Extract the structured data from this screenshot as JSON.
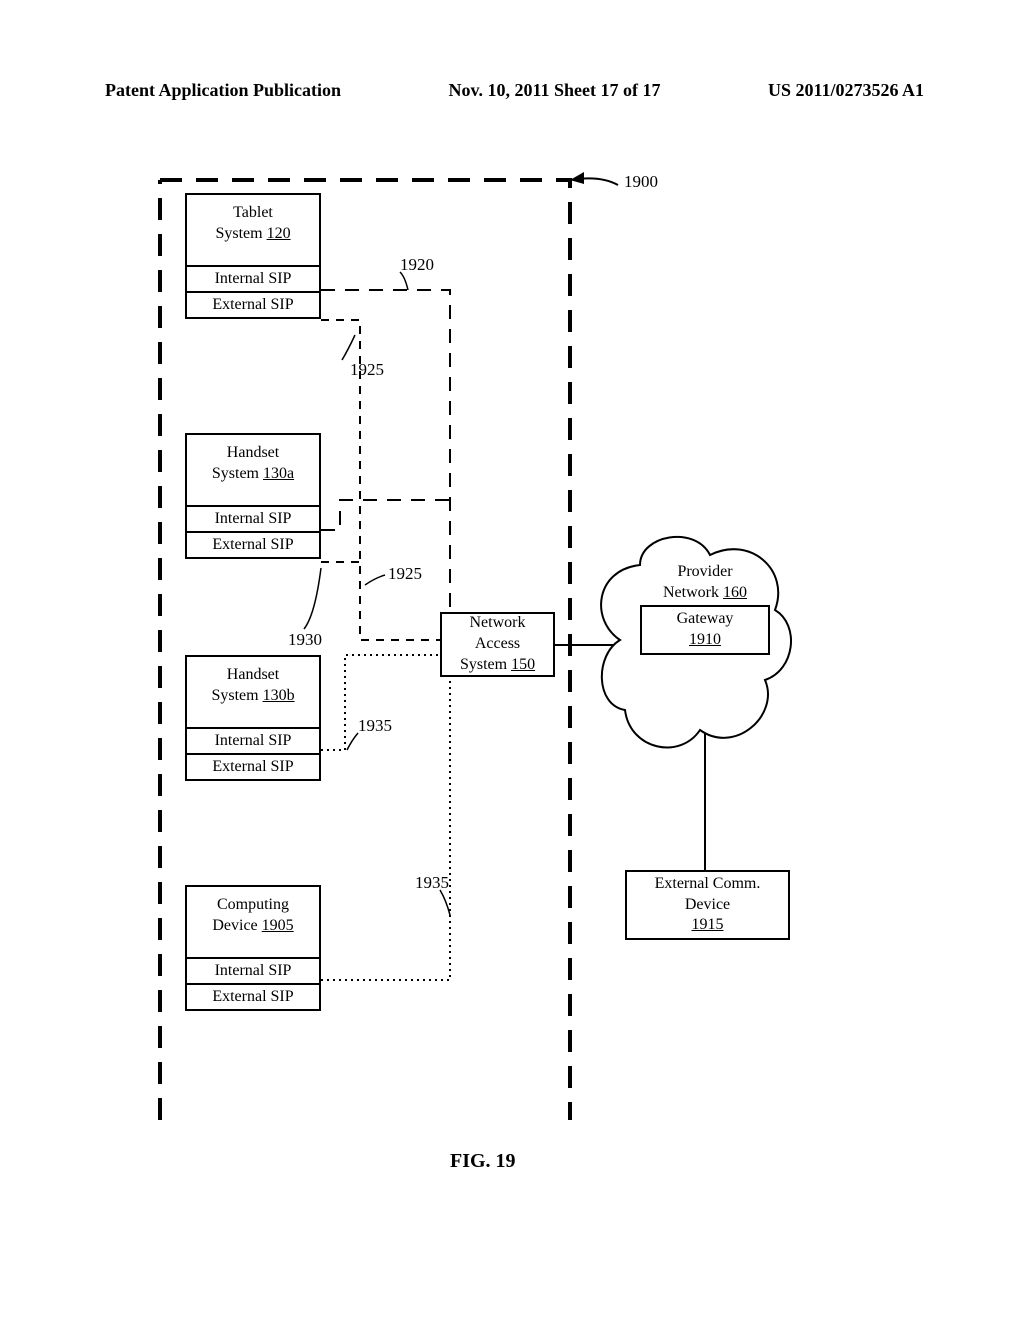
{
  "header": {
    "left": "Patent Application Publication",
    "center": "Nov. 10, 2011  Sheet 17 of 17",
    "right": "US 2011/0273526 A1"
  },
  "diagram": {
    "ref_main": "1900",
    "tablet": {
      "title": "Tablet",
      "subtitle": "System",
      "num": "120",
      "sip_int": "Internal SIP",
      "sip_ext": "External SIP"
    },
    "handset_a": {
      "title": "Handset",
      "subtitle": "System",
      "num": "130a",
      "sip_int": "Internal SIP",
      "sip_ext": "External SIP"
    },
    "handset_b": {
      "title": "Handset",
      "subtitle": "System",
      "num": "130b",
      "sip_int": "Internal SIP",
      "sip_ext": "External SIP"
    },
    "computing": {
      "title": "Computing",
      "subtitle": "Device",
      "num": "1905",
      "sip_int": "Internal SIP",
      "sip_ext": "External SIP"
    },
    "network_access": {
      "line1": "Network",
      "line2": "Access",
      "line3": "System",
      "num": "150"
    },
    "provider": {
      "line1": "Provider",
      "line2": "Network",
      "num": "160"
    },
    "gateway": {
      "title": "Gateway",
      "num": "1910"
    },
    "ext_comm": {
      "line1": "External Comm.",
      "line2": "Device",
      "num": "1915"
    },
    "labels": {
      "l1920": "1920",
      "l1925a": "1925",
      "l1925b": "1925",
      "l1930": "1930",
      "l1935a": "1935",
      "l1935b": "1935"
    },
    "caption": "FIG. 19"
  }
}
